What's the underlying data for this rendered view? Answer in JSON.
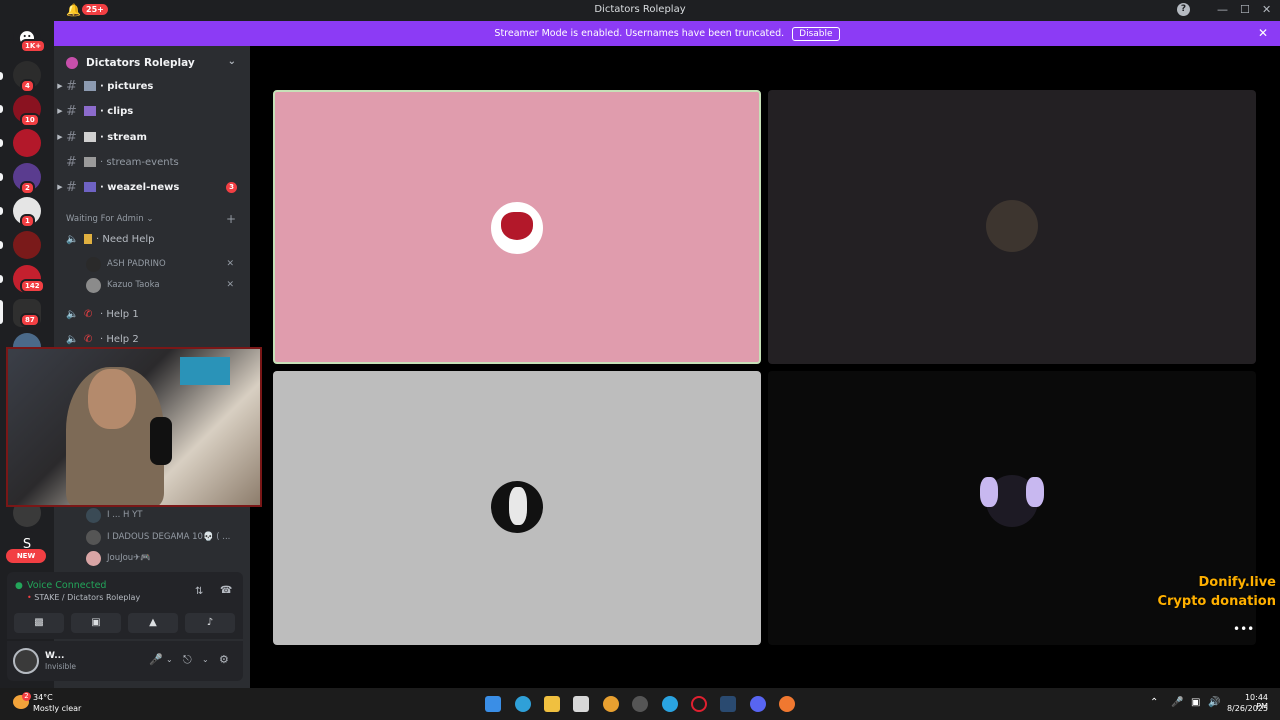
{
  "window": {
    "title": "Dictators Roleplay",
    "notification_count": "25+"
  },
  "notice": {
    "text": "Streamer Mode is enabled. Usernames have been truncated.",
    "button": "Disable"
  },
  "servers": {
    "badges": [
      "1K+",
      "4",
      "10",
      "2",
      "1",
      "142",
      "87"
    ],
    "new_label": "NEW"
  },
  "guild": {
    "name": "Dictators Roleplay"
  },
  "channels": [
    {
      "name": "pictures",
      "unread": true
    },
    {
      "name": "clips",
      "unread": true
    },
    {
      "name": "stream",
      "unread": true
    },
    {
      "name": "stream-events",
      "unread": false
    },
    {
      "name": "weazel-news",
      "unread": true,
      "mentions": "3"
    }
  ],
  "category": {
    "name": "Waiting For Admin"
  },
  "voice_channels": [
    {
      "name": "Need Help"
    },
    {
      "name": "Help 1"
    },
    {
      "name": "Help 2"
    }
  ],
  "voice_users": [
    {
      "name": "ASH PADRINO"
    },
    {
      "name": "Kazuo Taoka"
    }
  ],
  "lower_users": [
    {
      "name": "I ... H YT"
    },
    {
      "name": "I DADOUS DEGAMA 10💀 ( ..."
    },
    {
      "name": "JouJou✈🎮"
    }
  ],
  "voice": {
    "status": "Voice Connected",
    "location": "STAKE / Dictators Roleplay"
  },
  "user": {
    "name": "W...",
    "status": "Invisible"
  },
  "overlay": {
    "line1": "Donify.live",
    "line2": "Crypto donation"
  },
  "taskbar": {
    "temperature": "34°C",
    "condition": "Mostly clear",
    "time": "10:44 PM",
    "date": "8/26/2025",
    "weather_badge": "2"
  },
  "colors": {
    "accent": "#8c3bf5",
    "tile_pink": "#e09cad",
    "tile_gray": "#bdbdbd",
    "tile_dark": "#232023",
    "overlay": "#ffb000"
  }
}
